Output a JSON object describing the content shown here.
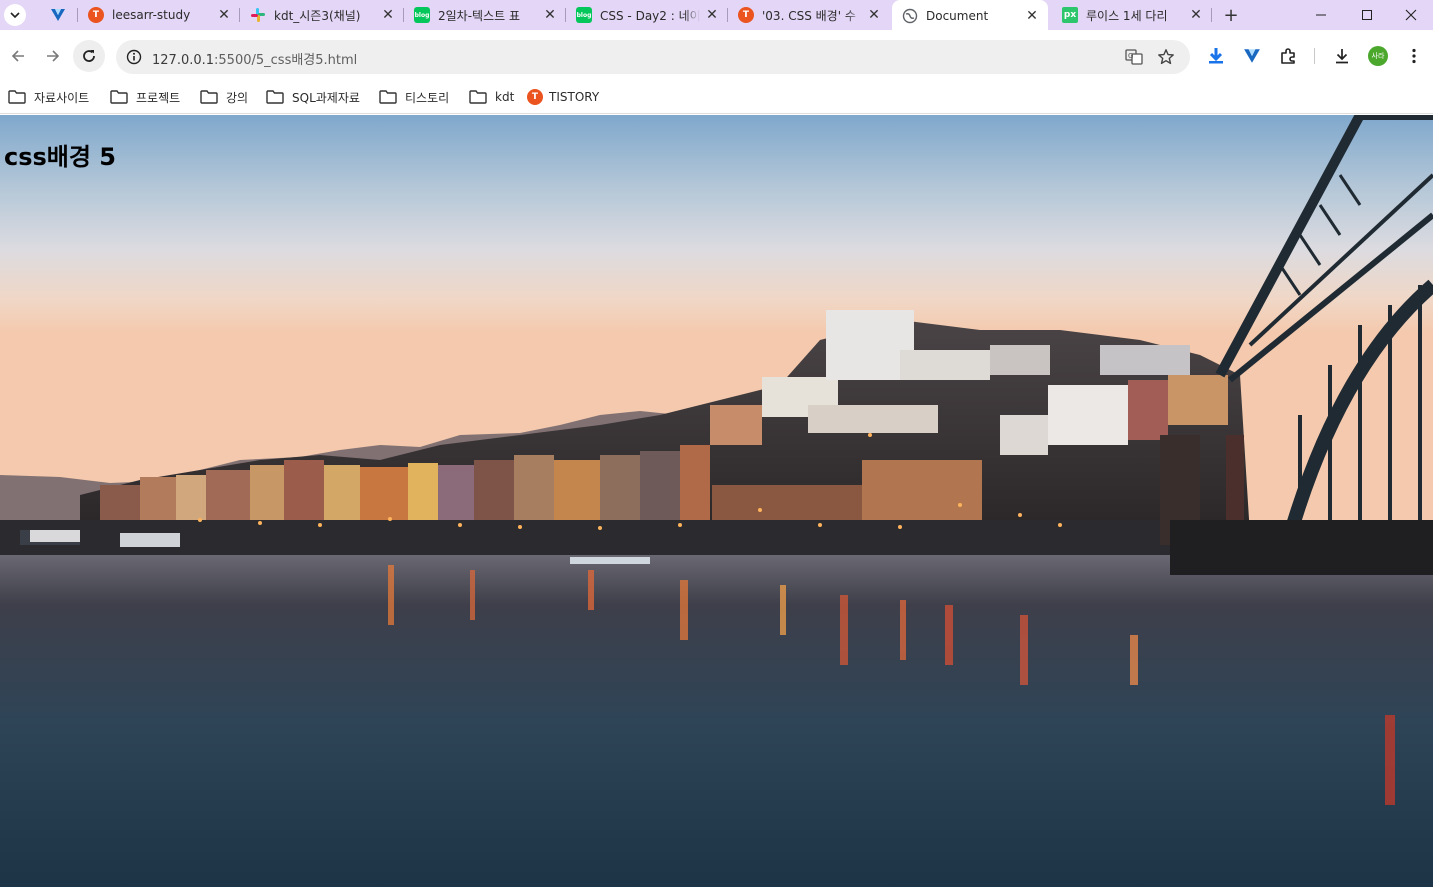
{
  "browser": {
    "tabs": [
      {
        "title": "",
        "icon": "vuetify-icon",
        "color": "#1867c0"
      },
      {
        "title": "leesarr-study",
        "icon": "tistory-icon",
        "color": "#eb531f"
      },
      {
        "title": "kdt_시즌3(채널)",
        "icon": "slack-icon",
        "color": "#e01e5a"
      },
      {
        "title": "2일차-텍스트 표",
        "icon": "blog-icon",
        "color": "#03c75a"
      },
      {
        "title": "CSS - Day2 : 네이",
        "icon": "blog-icon",
        "color": "#03c75a"
      },
      {
        "title": "'03. CSS 배경' 수",
        "icon": "tistory-icon",
        "color": "#eb531f"
      },
      {
        "title": "Document",
        "icon": "globe-icon",
        "color": "#5f6368",
        "active": true
      },
      {
        "title": "루이스 1세 다리",
        "icon": "pixabay-icon",
        "color": "#2ec66d"
      }
    ],
    "address_bar": {
      "url_host": "127.0.0.1",
      "url_rest": ":5500/5_css배경5.html"
    },
    "profile_initials": "사라",
    "bookmarks": [
      {
        "label": "자료사이트",
        "icon": "folder-icon"
      },
      {
        "label": "프로젝트",
        "icon": "folder-icon"
      },
      {
        "label": "강의",
        "icon": "folder-icon"
      },
      {
        "label": "SQL과제자료",
        "icon": "folder-icon"
      },
      {
        "label": "티스토리",
        "icon": "folder-icon"
      },
      {
        "label": "kdt",
        "icon": "folder-icon"
      },
      {
        "label": "TISTORY",
        "icon": "tistory-icon"
      }
    ]
  },
  "page": {
    "heading": "css배경 5",
    "background": "porto-riverside-dusk-photo"
  }
}
